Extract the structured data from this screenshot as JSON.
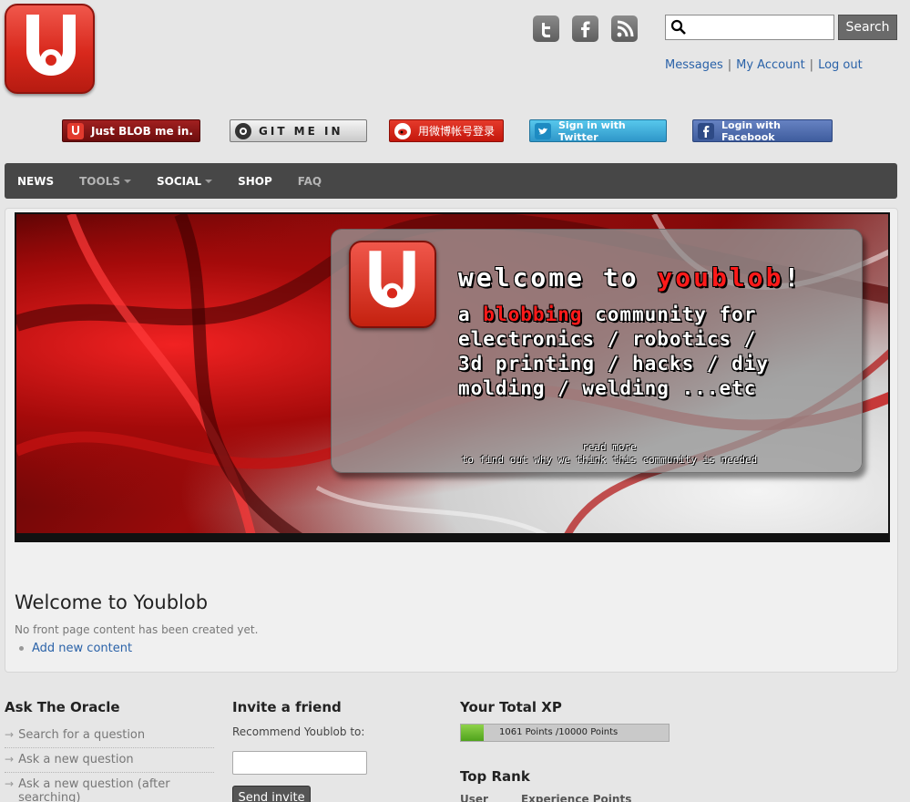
{
  "header": {
    "social_icons": [
      "twitter-icon",
      "facebook-icon",
      "rss-icon"
    ],
    "search": {
      "placeholder": "",
      "value": "",
      "button_label": "Search"
    },
    "account_links": [
      "Messages",
      "My Account",
      "Log out"
    ]
  },
  "login_buttons": {
    "blob": "Just BLOB me in.",
    "git": "GIT ME IN",
    "weibo": "用微博帐号登录",
    "twitter": "Sign in with Twitter",
    "facebook": "Login with Facebook"
  },
  "nav": {
    "items": [
      "NEWS",
      "TOOLS",
      "SOCIAL",
      "SHOP",
      "FAQ"
    ]
  },
  "banner": {
    "headline_part1": "welcome to ",
    "headline_brand": "youblob",
    "headline_end": "!",
    "tag_a": "a ",
    "tag_blob": "blobbing",
    "tag_rest1": " community for",
    "tag_line2": "electronics / robotics /",
    "tag_line3": "3d printing / hacks / diy",
    "tag_line4": "molding / welding ...etc",
    "read_more": "read more",
    "read_more_sub": "to find out why we think this community is needed"
  },
  "main": {
    "title": "Welcome to Youblob",
    "empty_text": "No front page content has been created yet.",
    "add_link": "Add new content"
  },
  "oracle": {
    "title": "Ask The Oracle",
    "items": [
      "Search for a question",
      "Ask a new question",
      "Ask a new question (after searching)"
    ]
  },
  "invite": {
    "title": "Invite a friend",
    "label": "Recommend Youblob to:",
    "button": "Send invite"
  },
  "xp": {
    "title": "Your Total XP",
    "points_text": "1061 Points /10000 Points",
    "progress": 0.1061
  },
  "rank": {
    "title": "Top Rank",
    "columns": [
      "User",
      "Experience Points"
    ]
  },
  "colors": {
    "brand_red": "#d8281c",
    "nav_bg": "#474747",
    "link": "#2a62a8",
    "xp_green": "#6cbf2e"
  }
}
